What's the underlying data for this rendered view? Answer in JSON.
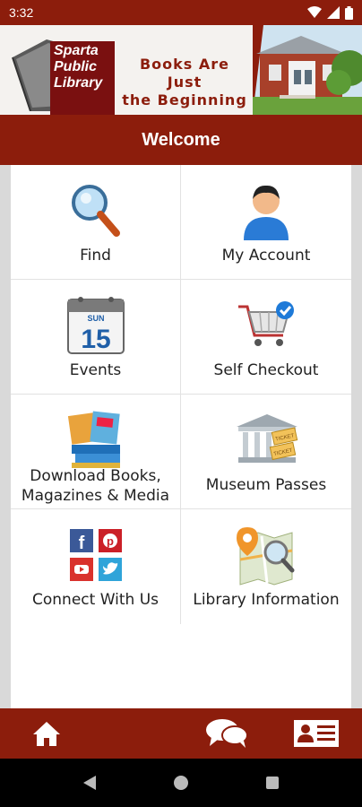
{
  "status_bar": {
    "time": "3:32"
  },
  "banner": {
    "logo_lines": [
      "Sparta",
      "Public",
      "Library"
    ],
    "slogan_lines": [
      "Books Are Just",
      "the Beginning"
    ]
  },
  "header": {
    "title": "Welcome"
  },
  "tiles": [
    {
      "label": "Find",
      "icon": "magnifier-icon"
    },
    {
      "label": "My Account",
      "icon": "user-icon"
    },
    {
      "label": "Events",
      "icon": "calendar-icon",
      "calendar_month": "SUN",
      "calendar_day": "15"
    },
    {
      "label": "Self Checkout",
      "icon": "shopping-cart-icon"
    },
    {
      "label": "Download Books, Magazines & Media",
      "label_lines": [
        "Download Books,",
        "Magazines & Media"
      ],
      "icon": "books-icon"
    },
    {
      "label": "Museum Passes",
      "icon": "museum-icon",
      "ticket_text": [
        "TICKET",
        "TICKET"
      ]
    },
    {
      "label": "Connect With Us",
      "icon": "social-icon"
    },
    {
      "label": "Library Information",
      "icon": "map-icon"
    }
  ],
  "bottom_nav": [
    {
      "name": "home",
      "icon": "home-icon"
    },
    {
      "name": "chat",
      "icon": "chat-icon"
    },
    {
      "name": "library-card",
      "icon": "id-card-icon"
    }
  ],
  "colors": {
    "brand": "#8c1d0c",
    "panel": "#ffffff",
    "page_bg": "#d9d9d9"
  }
}
